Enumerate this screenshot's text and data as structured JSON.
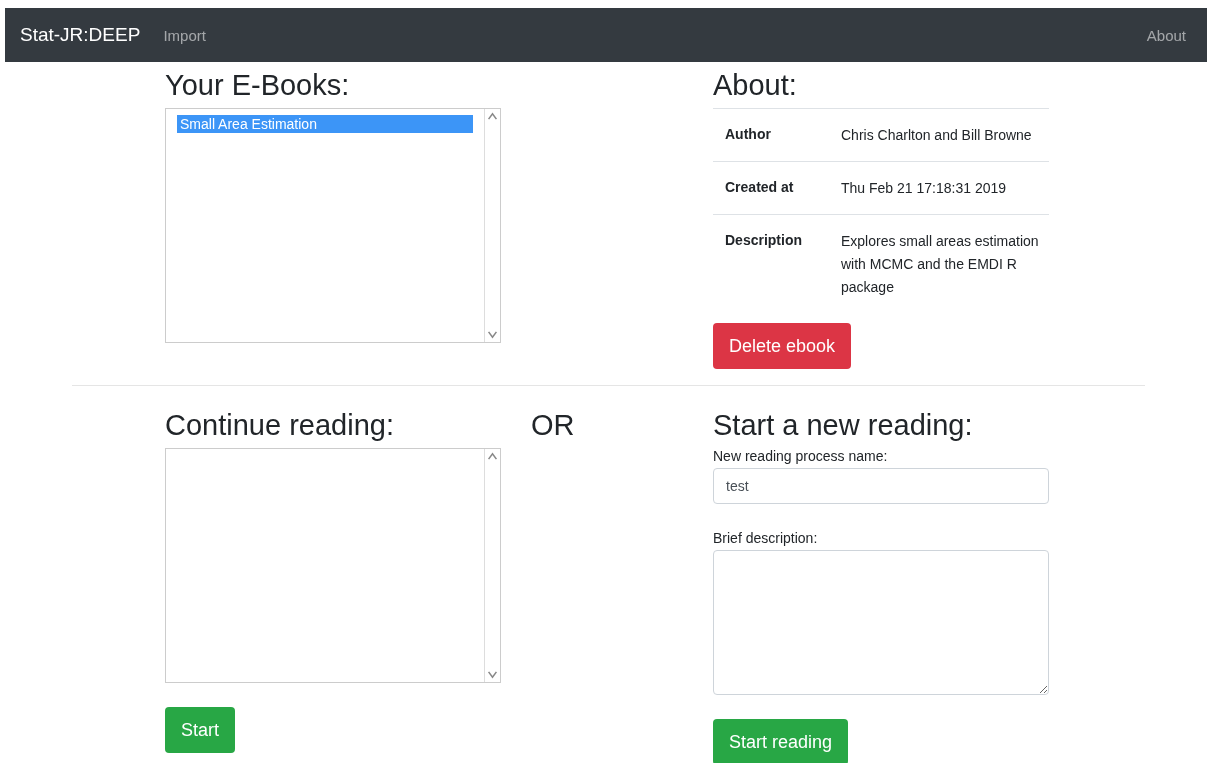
{
  "navbar": {
    "brand": "Stat-JR:DEEP",
    "links": [
      {
        "label": "Import"
      }
    ],
    "right_links": [
      {
        "label": "About"
      }
    ]
  },
  "ebooks": {
    "heading": "Your E-Books:",
    "items": [
      {
        "label": "Small Area Estimation",
        "selected": true
      }
    ]
  },
  "about": {
    "heading": "About:",
    "rows": [
      {
        "label": "Author",
        "value": "Chris Charlton and Bill Browne"
      },
      {
        "label": "Created at",
        "value": "Thu Feb 21 17:18:31 2019"
      },
      {
        "label": "Description",
        "value": "Explores small areas estimation with MCMC and the EMDI R package"
      }
    ],
    "delete_button": "Delete ebook"
  },
  "continue_reading": {
    "heading": "Continue reading:",
    "button": "Start"
  },
  "or_text": "OR",
  "new_reading": {
    "heading": "Start a new reading:",
    "name_label": "New reading process name:",
    "name_value": "test",
    "description_label": "Brief description:",
    "button": "Start reading"
  }
}
